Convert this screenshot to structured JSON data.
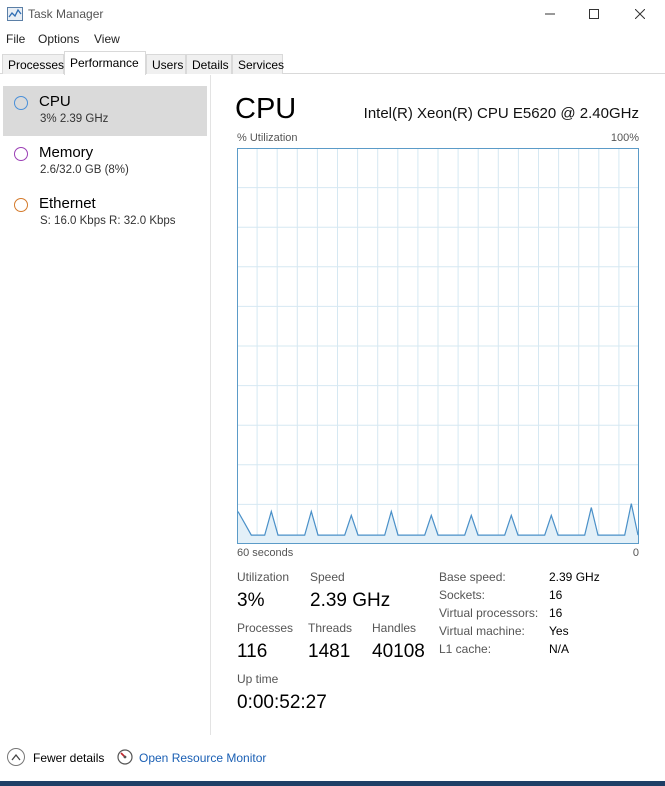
{
  "window": {
    "title": "Task Manager"
  },
  "menu": [
    "File",
    "Options",
    "View"
  ],
  "tabs": [
    "Processes",
    "Performance",
    "Users",
    "Details",
    "Services"
  ],
  "active_tab": "Performance",
  "sidebar": {
    "items": [
      {
        "title": "CPU",
        "sub": "3%  2.39 GHz",
        "color": "#4a90d9"
      },
      {
        "title": "Memory",
        "sub": "2.6/32.0 GB (8%)",
        "color": "#9b3fb5"
      },
      {
        "title": "Ethernet",
        "sub": "S: 16.0 Kbps  R: 32.0 Kbps",
        "color": "#d47a2b"
      }
    ]
  },
  "main": {
    "title": "CPU",
    "model": "Intel(R) Xeon(R) CPU E5620 @ 2.40GHz",
    "util_label": "% Utilization",
    "max_label": "100%",
    "time_label": "60 seconds",
    "zero_label": "0"
  },
  "chart_data": {
    "type": "area",
    "xlabel": "60 seconds",
    "ylabel": "% Utilization",
    "ylim": [
      0,
      100
    ],
    "xlim": [
      60,
      0
    ],
    "grid": true,
    "x": [
      60,
      59,
      58,
      57,
      56,
      55,
      54,
      53,
      52,
      51,
      50,
      49,
      48,
      47,
      46,
      45,
      44,
      43,
      42,
      41,
      40,
      39,
      38,
      37,
      36,
      35,
      34,
      33,
      32,
      31,
      30,
      29,
      28,
      27,
      26,
      25,
      24,
      23,
      22,
      21,
      20,
      19,
      18,
      17,
      16,
      15,
      14,
      13,
      12,
      11,
      10,
      9,
      8,
      7,
      6,
      5,
      4,
      3,
      2,
      1,
      0
    ],
    "series": [
      {
        "color": "#4a90c8",
        "values": [
          8,
          5,
          2,
          2,
          2,
          8,
          2,
          2,
          2,
          2,
          2,
          8,
          2,
          2,
          2,
          2,
          2,
          7,
          2,
          2,
          2,
          2,
          2,
          8,
          2,
          2,
          2,
          2,
          2,
          7,
          2,
          2,
          2,
          2,
          2,
          7,
          2,
          2,
          2,
          2,
          2,
          7,
          2,
          2,
          2,
          2,
          2,
          7,
          2,
          2,
          2,
          2,
          2,
          9,
          2,
          2,
          2,
          2,
          2,
          10,
          2
        ]
      }
    ]
  },
  "stats": {
    "utilization_label": "Utilization",
    "utilization": "3%",
    "speed_label": "Speed",
    "speed": "2.39 GHz",
    "processes_label": "Processes",
    "processes": "116",
    "threads_label": "Threads",
    "threads": "1481",
    "handles_label": "Handles",
    "handles": "40108",
    "uptime_label": "Up time",
    "uptime": "0:00:52:27"
  },
  "info": [
    {
      "label": "Base speed:",
      "value": "2.39 GHz"
    },
    {
      "label": "Sockets:",
      "value": "16"
    },
    {
      "label": "Virtual processors:",
      "value": "16"
    },
    {
      "label": "Virtual machine:",
      "value": "Yes"
    },
    {
      "label": "L1 cache:",
      "value": "N/A"
    }
  ],
  "footer": {
    "fewer": "Fewer details",
    "resmon": "Open Resource Monitor"
  }
}
